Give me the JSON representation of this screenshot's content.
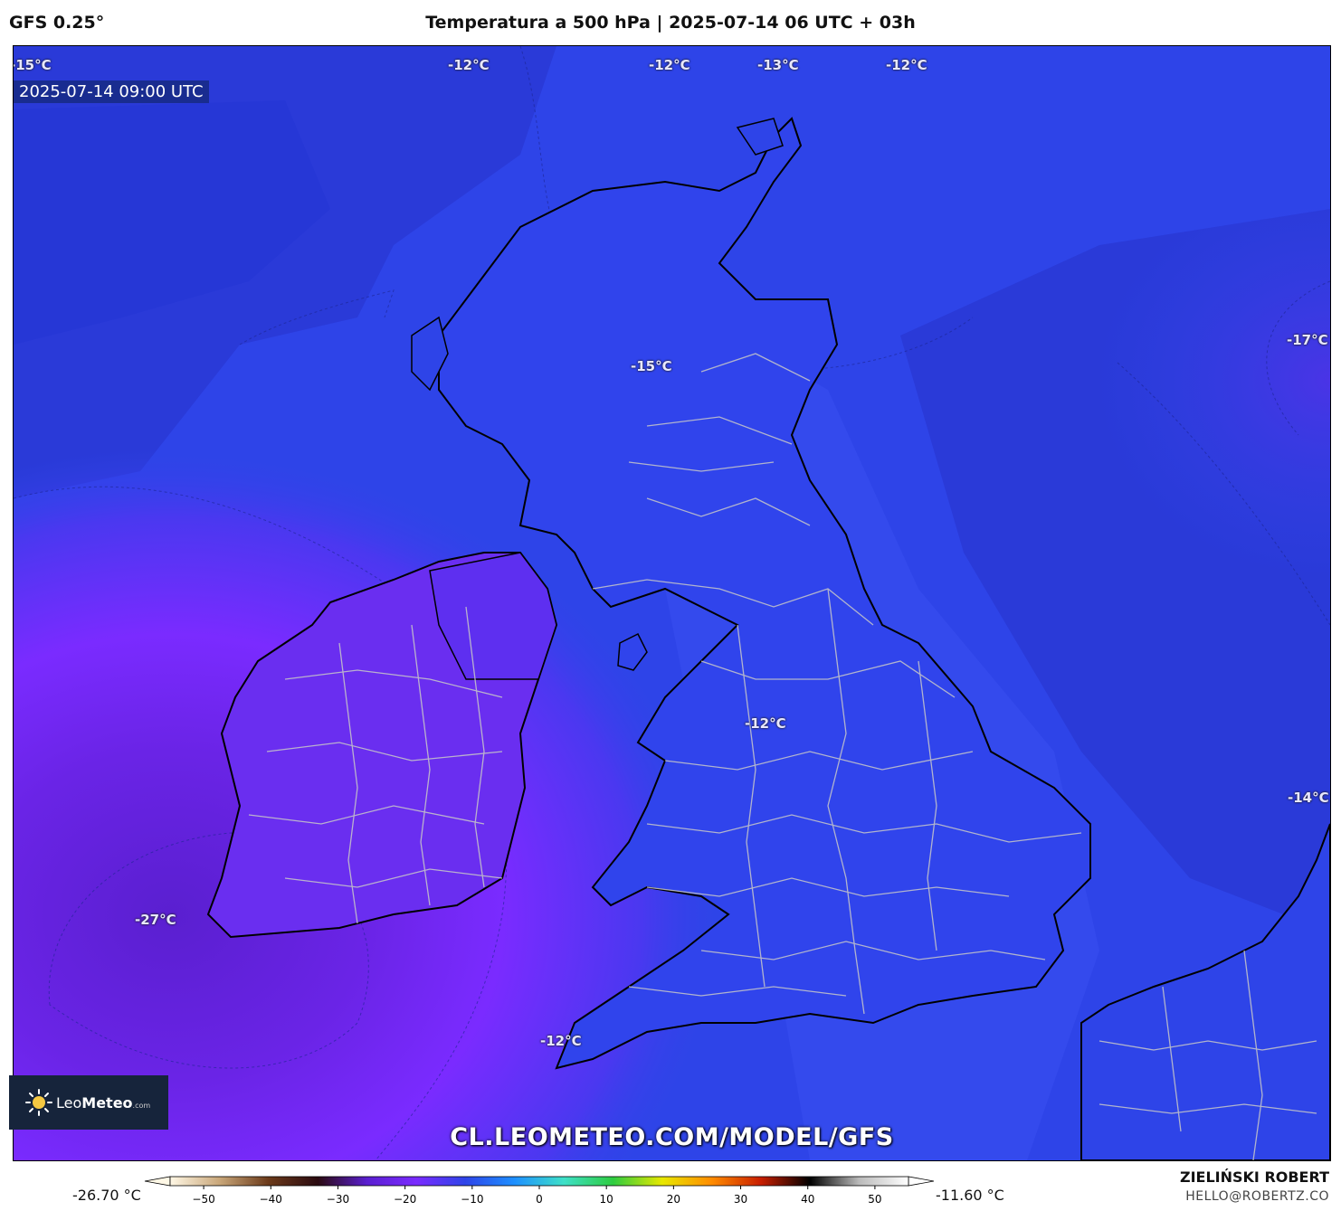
{
  "header": {
    "model": "GFS 0.25°",
    "title": "Temperatura a 500 hPa | 2025-07-14 06 UTC + 03h"
  },
  "map": {
    "timestamp": "2025-07-14 09:00 UTC",
    "watermark": "CL.LEOMETEO.COM/MODEL/GFS",
    "isotherm_labels": [
      "-15°C",
      "-12°C",
      "-12°C",
      "-13°C",
      "-12°C",
      "-17°C",
      "-15°C",
      "-12°C",
      "-14°C",
      "-27°C",
      "-12°C"
    ],
    "colors": {
      "base_blue": "#2e44e8",
      "dark_blue": "#2637d6",
      "light_blue": "#3a50f0",
      "violet": "#6a2ef0",
      "purple": "#7a2bff",
      "deep_purple": "#5a1fd0",
      "coast": "#000000",
      "borders": "#c8c8c8"
    }
  },
  "logo": {
    "name_light": "Leo",
    "name_bold": "Meteo",
    "suffix": ".com"
  },
  "colorbar": {
    "min_label": "-26.70 °C",
    "max_label": "-11.60 °C",
    "ticks": [
      "−50",
      "−40",
      "−30",
      "−20",
      "−10",
      "0",
      "10",
      "20",
      "30",
      "40",
      "50"
    ],
    "range": [
      -55,
      55
    ],
    "stops": [
      "#fff8e6",
      "#c9a77a",
      "#6b3a1a",
      "#2a0a10",
      "#5a1fd0",
      "#7a2bff",
      "#2e44e8",
      "#1e90ff",
      "#3ee0c8",
      "#2ecc40",
      "#e8e800",
      "#ff8c00",
      "#c81e00",
      "#000000",
      "#bbbbbb",
      "#ffffff"
    ]
  },
  "footer": {
    "author": "ZIELIŃSKI ROBERT",
    "email": "HELLO@ROBERTZ.CO"
  }
}
